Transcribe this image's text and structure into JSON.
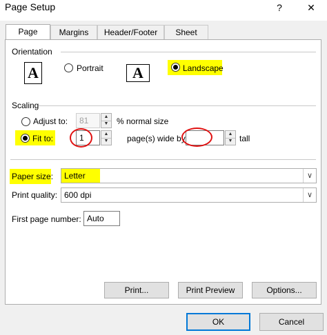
{
  "window": {
    "title": "Page Setup",
    "help_glyph": "?",
    "close_glyph": "✕"
  },
  "tabs": [
    {
      "label": "Page",
      "active": true
    },
    {
      "label": "Margins",
      "active": false
    },
    {
      "label": "Header/Footer",
      "active": false
    },
    {
      "label": "Sheet",
      "active": false
    }
  ],
  "orientation": {
    "heading": "Orientation",
    "portrait_label": "Portrait",
    "landscape_label": "Landscape",
    "selected": "Landscape",
    "icon_glyph": "A"
  },
  "scaling": {
    "heading": "Scaling",
    "adjust_label": "Adjust to:",
    "adjust_value": "81",
    "adjust_suffix": "% normal size",
    "fit_label": "Fit to:",
    "fit_wide_value": "1",
    "fit_wide_suffix": "page(s) wide by",
    "fit_tall_value": "",
    "fit_tall_suffix": "tall",
    "selected": "Fit to"
  },
  "paper_size": {
    "label": "Paper size:",
    "value": "Letter"
  },
  "print_quality": {
    "label": "Print quality:",
    "value": "600 dpi"
  },
  "first_page": {
    "label": "First page number:",
    "value": "Auto"
  },
  "buttons": {
    "print": "Print...",
    "preview": "Print Preview",
    "options": "Options...",
    "ok": "OK",
    "cancel": "Cancel"
  },
  "colors": {
    "highlight": "#ffff00",
    "annotation": "#e01010",
    "focus": "#0078d7"
  }
}
